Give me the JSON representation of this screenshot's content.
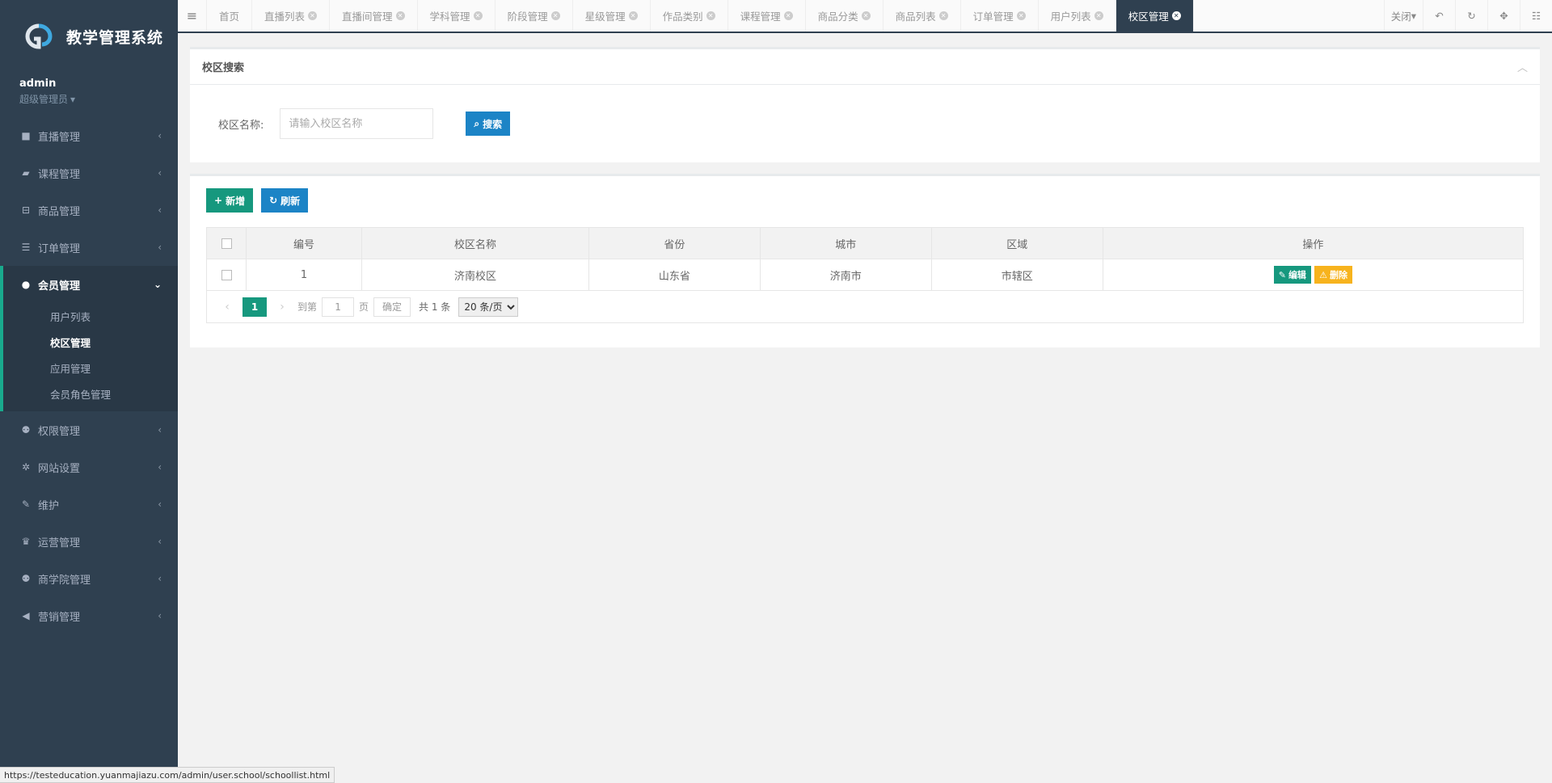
{
  "app": {
    "title": "教学管理系统",
    "user_name": "admin",
    "user_role": "超级管理员"
  },
  "sidebar": {
    "items": [
      {
        "label": "直播管理",
        "icon": "video-camera-icon"
      },
      {
        "label": "课程管理",
        "icon": "book-icon"
      },
      {
        "label": "商品管理",
        "icon": "cart-icon"
      },
      {
        "label": "订单管理",
        "icon": "list-icon"
      },
      {
        "label": "会员管理",
        "icon": "user-icon"
      },
      {
        "label": "权限管理",
        "icon": "users-icon"
      },
      {
        "label": "网站设置",
        "icon": "gear-icon"
      },
      {
        "label": "维护",
        "icon": "wrench-icon"
      },
      {
        "label": "运营管理",
        "icon": "trophy-icon"
      },
      {
        "label": "商学院管理",
        "icon": "users-icon"
      },
      {
        "label": "营销管理",
        "icon": "bullhorn-icon"
      }
    ],
    "member_sub": [
      "用户列表",
      "校区管理",
      "应用管理",
      "会员角色管理"
    ]
  },
  "tabs": [
    "首页",
    "直播列表",
    "直播间管理",
    "学科管理",
    "阶段管理",
    "星级管理",
    "作品类别",
    "课程管理",
    "商品分类",
    "商品列表",
    "订单管理",
    "用户列表",
    "校区管理"
  ],
  "toolbar": {
    "close_label": "关闭"
  },
  "search_panel": {
    "title": "校区搜索",
    "field_label": "校区名称:",
    "placeholder": "请输入校区名称",
    "search_label": "搜索"
  },
  "list_panel": {
    "add_label": "新增",
    "refresh_label": "刷新",
    "columns": [
      "编号",
      "校区名称",
      "省份",
      "城市",
      "区域",
      "操作"
    ],
    "rows": [
      {
        "id": "1",
        "name": "济南校区",
        "province": "山东省",
        "city": "济南市",
        "district": "市辖区"
      }
    ],
    "edit_label": "编辑",
    "delete_label": "删除"
  },
  "pager": {
    "current": "1",
    "goto_label": "到第",
    "goto_value": "1",
    "page_unit": "页",
    "confirm_label": "确定",
    "total": "共 1 条",
    "page_size": "20 条/页"
  },
  "status_url": "https://testeducation.yuanmajiazu.com/admin/user.school/schoollist.html",
  "colors": {
    "sidebar_bg": "#2f4050",
    "primary": "#16987e",
    "info": "#1c84c6",
    "warning": "#f7b31d"
  }
}
